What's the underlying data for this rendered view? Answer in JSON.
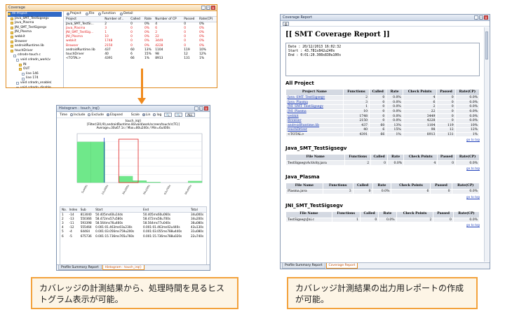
{
  "coverage": {
    "title": "Coverage",
    "tree": [
      {
        "label": "All Project",
        "kind": "folder",
        "indent": 0,
        "selected": true
      },
      {
        "label": "Java_SMT_TestSigsegv",
        "kind": "folder",
        "indent": 1
      },
      {
        "label": "Java_Plasma",
        "kind": "folder",
        "indent": 1
      },
      {
        "label": "JNI_SMT_TestSigsegv",
        "kind": "folder",
        "indent": 1
      },
      {
        "label": "JNI_Plasma",
        "kind": "folder",
        "indent": 1
      },
      {
        "label": "webkit",
        "kind": "folder",
        "indent": 1
      },
      {
        "label": "Browser",
        "kind": "folder",
        "indent": 1
      },
      {
        "label": "androidRuntime.lib",
        "kind": "folder",
        "indent": 1
      },
      {
        "label": "touchDriver",
        "kind": "folder",
        "indent": 1
      },
      {
        "label": "cdrodn-touch.c",
        "kind": "file",
        "indent": 2
      },
      {
        "label": "void cdrodn_work(v",
        "kind": "file",
        "indent": 3
      },
      {
        "label": "IN",
        "kind": "folder",
        "indent": 4
      },
      {
        "label": "OUT",
        "kind": "folder",
        "indent": 4
      },
      {
        "label": "line 146",
        "kind": "file",
        "indent": 5
      },
      {
        "label": "line 174",
        "kind": "file",
        "indent": 5
      },
      {
        "label": "void cdrodn_enable(",
        "kind": "file",
        "indent": 3
      },
      {
        "label": "void cdrodn_disable",
        "kind": "file",
        "indent": 3
      },
      {
        "label": "int cdrodn_early_sus",
        "kind": "file",
        "indent": 3
      }
    ],
    "view_options": [
      {
        "label": "Project",
        "on": true
      },
      {
        "label": "File",
        "on": false
      },
      {
        "label": "Function",
        "on": false
      },
      {
        "label": "Detail",
        "on": false
      }
    ],
    "columns": [
      "Project",
      "Number of...",
      "Called",
      "Rate",
      "Number of CP",
      "Passed",
      "Rate(CP)"
    ],
    "rows": [
      {
        "cells": [
          "Java_SMT_TestSi...",
          "2",
          "0",
          "0%",
          "4",
          "0",
          "0%"
        ],
        "red": false
      },
      {
        "cells": [
          "Java_Plasma",
          "3",
          "0",
          "0%",
          "6",
          "0",
          "0%"
        ],
        "red": true
      },
      {
        "cells": [
          "JNI_SMT_TestSig...",
          "1",
          "0",
          "0%",
          "2",
          "0",
          "0%"
        ],
        "red": true
      },
      {
        "cells": [
          "JNI_Plasma",
          "10",
          "0",
          "0%",
          "22",
          "0",
          "0%"
        ],
        "red": true
      },
      {
        "cells": [
          "webkit",
          "1748",
          "0",
          "0%",
          "3449",
          "0",
          "0%"
        ],
        "red": true
      },
      {
        "cells": [
          "Browser",
          "2150",
          "0",
          "0%",
          "4228",
          "0",
          "0%"
        ],
        "red": true
      },
      {
        "cells": [
          "androidRuntime.lib",
          "437",
          "60",
          "13%",
          "1104",
          "119",
          "10%"
        ],
        "red": false
      },
      {
        "cells": [
          "touchDriver",
          "40",
          "6",
          "15%",
          "98",
          "12",
          "12%"
        ],
        "red": false
      },
      {
        "cells": [
          "<TOTAL>",
          "4391",
          "66",
          "1%",
          "8913",
          "131",
          "1%"
        ],
        "red": false
      }
    ]
  },
  "histogram": {
    "title": "Histogram : touch_irq()",
    "controls": {
      "time_label": "Time",
      "include_label": "Include",
      "exclude_label": "Exclude",
      "elapsed_label": "Elapsed",
      "scale_label": "Scale",
      "lin_label": "Lin",
      "log_label": "log",
      "all_label": "ALL"
    },
    "head_title": "touch_irq()",
    "head_path": "[Filter(l20,l9),androidRuntime.lib/void/work/screen/touch/c(TC)]",
    "head_stats": "Average=30u67.1s / Max=80u240s / Min=6u400s",
    "table_columns": [
      "No.",
      "Index",
      "Sub",
      "Start",
      "End",
      "Total"
    ],
    "table_rows": [
      [
        "1",
        "-14",
        "813040",
        "50.405ms60u14ds",
        "50.405ms60u060s",
        "34u000s"
      ],
      [
        "2",
        "-13",
        "550366",
        "58.472ms57u580s",
        "58.472ms56u700s",
        "34u200s"
      ],
      [
        "3",
        "-11",
        "593398",
        "58.564ms76u460s",
        "58.564ms77u040s",
        "36u080s"
      ],
      [
        "4",
        "-12",
        "555464",
        "0.001:01.463ms03u230s",
        "0.001:01.463ms02u440s",
        "43u130s"
      ],
      [
        "5",
        "-4",
        "64464",
        "0.001:03.056ms759u200s",
        "0.001:03.055ms788u440s",
        "31u080s"
      ],
      [
        "6",
        "-5",
        "675736",
        "0.001:15.736ms765u760s",
        "0.001:15.736ms788u020s",
        "22u740s"
      ]
    ],
    "tabs": [
      "Profile Summary Report",
      "Histogram : touch_irq()"
    ],
    "chart_data": {
      "type": "bar",
      "title": "",
      "xlabel": "",
      "ylabel": "",
      "categories": [
        "1",
        "2",
        "3",
        "4",
        "5",
        "6",
        "7",
        "8",
        "9"
      ],
      "values": [
        83,
        83,
        0,
        13,
        4,
        1,
        0,
        0,
        3
      ],
      "ylim": [
        0,
        100
      ],
      "x_tick_labels": [
        "5u400s",
        "22u300s",
        "39u300s",
        "56u200s",
        "63u700s",
        "90u000s"
      ],
      "grid": true,
      "bar_color": "#6fe88a",
      "marker_color": "#1f3fcf",
      "highlight_color": "#e02020"
    }
  },
  "report": {
    "title": "Coverage Report",
    "heading": "[[ SMT Coverage Report ]]",
    "meta": [
      "Date : 20/12/2013 16:02:32",
      "Start : 43.781s842u240s",
      "End : 0:01:20.308s830u100s"
    ],
    "all_project": {
      "heading": "All Project",
      "columns": [
        "Project Name",
        "Functions",
        "Called",
        "Rate",
        "Check Points",
        "Passed",
        "Rate(CP)"
      ],
      "rows": [
        {
          "cells": [
            "Java_SMT_TestSigsegv",
            "2",
            "0",
            "0.0%",
            "4",
            "0",
            "0.0%"
          ],
          "link": true,
          "hl": false
        },
        {
          "cells": [
            "Java_Plasma",
            "3",
            "0",
            "0.0%",
            "6",
            "0",
            "0.0%"
          ],
          "link": true,
          "hl": false
        },
        {
          "cells": [
            "JNI_SMT_TestSigsegv",
            "1",
            "0",
            "0.0%",
            "2",
            "0",
            "0.0%"
          ],
          "link": true,
          "hl": false
        },
        {
          "cells": [
            "JNI_Plasma",
            "10",
            "0",
            "0.0%",
            "22",
            "0",
            "0.0%"
          ],
          "link": true,
          "hl": false
        },
        {
          "cells": [
            "webkit",
            "1748",
            "0",
            "0.0%",
            "3449",
            "0",
            "0.0%"
          ],
          "link": true,
          "hl": false
        },
        {
          "cells": [
            "Browser",
            "2150",
            "0",
            "0.0%",
            "4228",
            "0",
            "0.0%"
          ],
          "link": true,
          "hl": false
        },
        {
          "cells": [
            "androidRuntime.lib",
            "437",
            "60",
            "13%",
            "1104",
            "119",
            "10%"
          ],
          "link": true,
          "hl": true
        },
        {
          "cells": [
            "touchDriver",
            "40",
            "6",
            "15%",
            "98",
            "12",
            "12%"
          ],
          "link": true,
          "hl": true
        },
        {
          "cells": [
            "<TOTAL>",
            "4391",
            "66",
            "1%",
            "8913",
            "131",
            "1%"
          ],
          "link": false,
          "hl": true
        }
      ]
    },
    "sections": [
      {
        "heading": "Java_SMT_TestSigsegv",
        "row": [
          "TestSigsegvActivity.java",
          "2",
          "0",
          "0.0%",
          "4",
          "0",
          "0.0%"
        ]
      },
      {
        "heading": "Java_Plasma",
        "row": [
          "Plasma.java",
          "3",
          "0",
          "0.0%",
          "6",
          "0",
          "0.0%"
        ]
      },
      {
        "heading": "JNI_SMT_TestSigsegv",
        "row": [
          "TestSigsegvJni.c",
          "1",
          "0",
          "0.0%",
          "2",
          "0",
          "0.0%"
        ]
      }
    ],
    "file_columns": [
      "File Name",
      "Functions",
      "Called",
      "Rate",
      "Check Points",
      "Passed",
      "Rate(CP)"
    ],
    "go_to_top": "go to top",
    "tabs": [
      "Profile Summary Report",
      "Coverage Report"
    ]
  },
  "callouts": {
    "left": "カバレッジの計測結果から、処理時間を見るヒストグラム表示が可能。",
    "right": "カバレッジ計測結果の出力用レポートの作成が可能。"
  },
  "colors": {
    "accent_orange": "#f08a1c",
    "callout_border": "#f3a23c",
    "callout_bg": "#fdf5e6"
  }
}
